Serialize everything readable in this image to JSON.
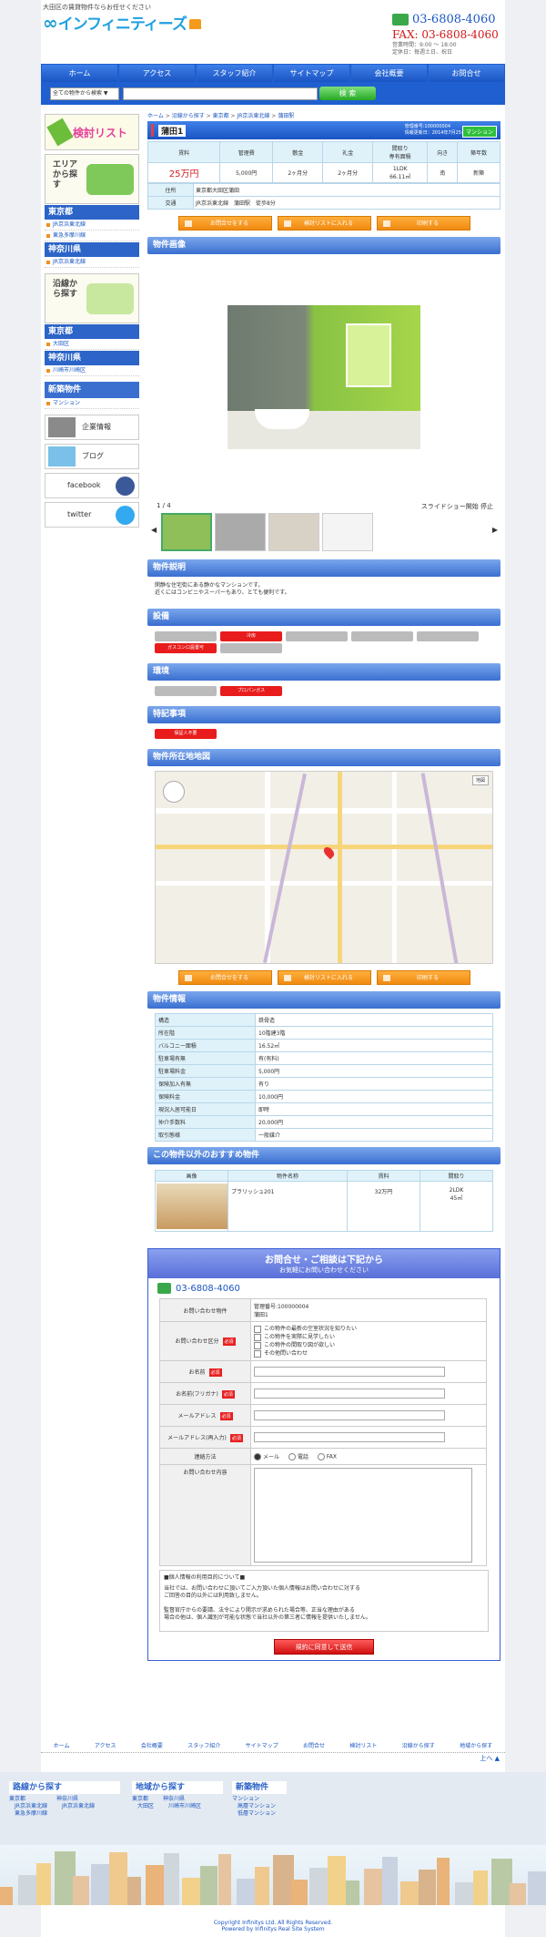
{
  "header": {
    "tagline": "大田区の賃貸物件ならお任せください",
    "logo_mark": "∞",
    "logo_name": "インフィニティーズ",
    "tel": "03-6808-4060",
    "fax": "FAX: 03-6808-4060",
    "hours": "営業時間：9:00 ～ 18:00",
    "holiday": "定休日：毎週土日、祝日"
  },
  "gnav": [
    "ホーム",
    "アクセス",
    "スタッフ紹介",
    "サイトマップ",
    "会社概要",
    "お問合せ"
  ],
  "search": {
    "select": "全ての物件から検索 ▼",
    "button": "検 索"
  },
  "sidebar": {
    "list_banner": "検討リスト",
    "area_title": "エリアから探す",
    "area_groups": [
      {
        "name": "東京都",
        "links": [
          "JR京浜東北線",
          "東急多摩川線"
        ]
      },
      {
        "name": "神奈川県",
        "links": [
          "JR京浜東北線"
        ]
      }
    ],
    "line_title": "沿線から探す",
    "line_groups": [
      {
        "name": "東京都",
        "links": [
          "大田区"
        ]
      },
      {
        "name": "神奈川県",
        "links": [
          "川崎市川崎区"
        ]
      }
    ],
    "new_title": "新築物件",
    "new_links": [
      "マンション"
    ],
    "banners": [
      "企業情報",
      "ブログ",
      "facebook",
      "twitter"
    ]
  },
  "breadcrumb": [
    "ホーム",
    "沿線から探す",
    "東京都",
    "JR京浜東北線",
    "蒲田駅"
  ],
  "property": {
    "title": "蒲田1",
    "mgmt_no": "管理番号:100000004",
    "updated": "情報更新日：2014年7月25日",
    "badge": "マンション",
    "spec_headers": [
      "賃料",
      "管理費",
      "敷金",
      "礼金",
      "間取り\n専有面積",
      "向き",
      "築年数"
    ],
    "spec_values": [
      "25万円",
      "5,000円",
      "2ヶ月分",
      "2ヶ月分",
      "1LDK\n66.11㎡",
      "南",
      "新築"
    ],
    "address_label": "住所",
    "address": "東京都大田区蒲田",
    "transport_label": "交通",
    "transport": "JR京浜東北線　蒲田駅　徒歩8分"
  },
  "buttons": [
    "お問合せをする",
    "検討リストに入れる",
    "印刷する"
  ],
  "sections": {
    "images": "物件画像",
    "desc": "物件説明",
    "equip": "設備",
    "env": "環境",
    "special": "特記事項",
    "map": "物件所在地地図",
    "info": "物件情報",
    "recommend": "この物件以外のおすすめ物件"
  },
  "gallery": {
    "counter": "1 / 4",
    "controls": "スライドショー開始 停止"
  },
  "desc_text": "閑静な住宅街にある静かなマンションです。\n近くにはコンビニやスーパーもあり、とても便利です。",
  "equipment": [
    {
      "label": "",
      "on": false
    },
    {
      "label": "冷房",
      "on": true
    },
    {
      "label": "",
      "on": false
    },
    {
      "label": "",
      "on": false
    },
    {
      "label": "",
      "on": false
    },
    {
      "label": "ガスコンロ設置可",
      "on": true
    },
    {
      "label": "",
      "on": false
    }
  ],
  "environment": [
    {
      "label": "",
      "on": false
    },
    {
      "label": "プロパンガス",
      "on": true
    }
  ],
  "special_tags": [
    {
      "label": "保証人不要",
      "on": true
    }
  ],
  "map": {
    "type": "地図"
  },
  "info_rows": [
    [
      "構造",
      "鉄骨造"
    ],
    [
      "所在階",
      "10階建3階"
    ],
    [
      "バルコニー面積",
      "16.52㎡"
    ],
    [
      "駐車場有無",
      "有(有料)"
    ],
    [
      "駐車場料金",
      "5,000円"
    ],
    [
      "保険加入有無",
      "有り"
    ],
    [
      "保険料金",
      "10,000円"
    ],
    [
      "現況入居可能日",
      "即時"
    ],
    [
      "仲介手数料",
      "20,000円"
    ],
    [
      "取引態様",
      "一般媒介"
    ]
  ],
  "recommend": {
    "headers": [
      "画像",
      "物件名称",
      "賃料",
      "間取り"
    ],
    "rows": [
      {
        "name": "プラリッシュ201",
        "rent": "32万円",
        "layout": "2LDK\n45㎡"
      }
    ]
  },
  "form": {
    "title": "お問合せ・ご相談は下記から",
    "subtitle": "お気軽にお問い合わせください",
    "tel": "03-6808-4060",
    "rows": [
      {
        "label": "お問い合わせ物件",
        "req": false
      },
      {
        "label": "お問い合わせ区分",
        "req": true
      },
      {
        "label": "お名前",
        "req": true
      },
      {
        "label": "お名前(フリガナ)",
        "req": true
      },
      {
        "label": "メールアドレス",
        "req": true
      },
      {
        "label": "メールアドレス(再入力)",
        "req": true
      },
      {
        "label": "連絡方法",
        "req": false
      },
      {
        "label": "お問い合わせ内容",
        "req": false
      }
    ],
    "req_label": "必須",
    "inquiry_property": "管理番号:100000004\n蒲田1",
    "categories": [
      "この物件の最新の空室状況を知りたい",
      "この物件を実際に見学したい",
      "この物件の間取り図が欲しい",
      "その他問い合わせ"
    ],
    "methods": [
      "メール",
      "電話",
      "FAX"
    ],
    "privacy_title": "■個人情報の利用目的について■",
    "privacy_text": "当社では、お問い合わせに頂いてご入力頂いた個人情報はお問い合わせに対する\nご回答の目的以外には利用致しません。\n\n監督官庁からの要請、法令により開示が求められた場合等、正当な理由がある\n場合の他は、個人識別が可能な状態で当社以外の第三者に情報を提供いたしません。",
    "submit": "規約に同意して送信"
  },
  "footer_nav": [
    "ホーム",
    "アクセス",
    "会社概要",
    "スタッフ紹介",
    "サイトマップ",
    "お問合せ",
    "検討リスト",
    "沿線から探す",
    "地域から探す"
  ],
  "to_top": "上へ",
  "footer": {
    "cols": [
      {
        "title": "路線から探す",
        "groups": [
          {
            "name": "東京都",
            "links": [
              "JR京浜東北線",
              "東急多摩川線"
            ]
          },
          {
            "name": "神奈川県",
            "links": [
              "JR京浜東北線"
            ]
          }
        ]
      },
      {
        "title": "地域から探す",
        "groups": [
          {
            "name": "東京都",
            "links": [
              "大田区"
            ]
          },
          {
            "name": "神奈川県",
            "links": [
              "川崎市川崎区"
            ]
          }
        ]
      },
      {
        "title": "新築物件",
        "groups": [
          {
            "name": "マンション",
            "links": [
              "高層マンション",
              "低層マンション"
            ]
          }
        ]
      }
    ],
    "copyright": "Copyright Infinitys Ltd. All Rights Reserved.",
    "powered": "Powered by Infinitys Real Site System"
  }
}
